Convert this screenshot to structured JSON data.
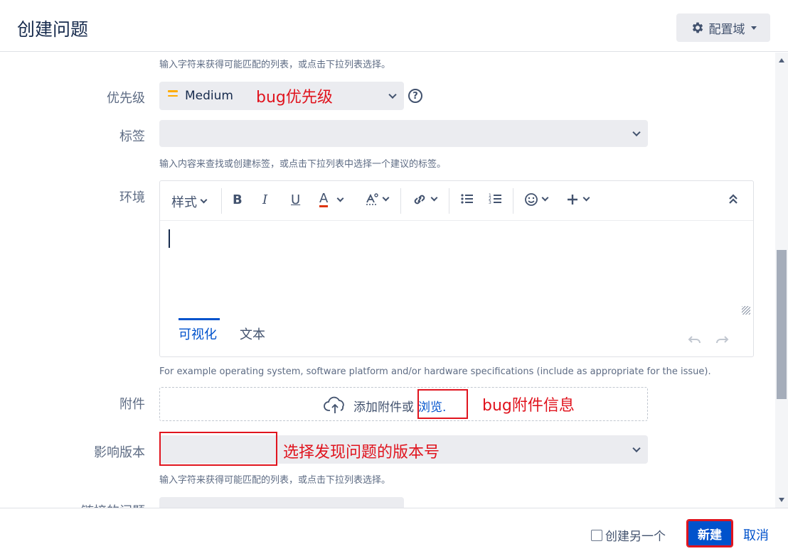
{
  "header": {
    "title": "创建问题",
    "config_label": "配置域"
  },
  "form": {
    "component_help": "输入字符来获得可能匹配的列表，或点击下拉列表选择。",
    "priority": {
      "label": "优先级",
      "value": "Medium",
      "icon": "priority-medium-icon",
      "annotation": "bug优先级"
    },
    "labels": {
      "label": "标签",
      "help": "输入内容来查找或创建标签，或点击下拉列表中选择一个建议的标签。"
    },
    "environment": {
      "label": "环境",
      "toolbar": {
        "style_label": "样式",
        "bold": "B",
        "italic": "I",
        "underline": "U",
        "text_color": "A"
      },
      "tabs": [
        "可视化",
        "文本"
      ],
      "help": "For example operating system, software platform and/or hardware specifications (include as appropriate for the issue)."
    },
    "attachment": {
      "label": "附件",
      "drop_text": "添加附件或",
      "browse_link": "浏览.",
      "annotation": "bug附件信息"
    },
    "affects_version": {
      "label": "影响版本",
      "annotation": "选择发现问题的版本号",
      "help": "输入字符来获得可能匹配的列表，或点击下拉列表选择。"
    },
    "next_label_partial": "链接的问题"
  },
  "footer": {
    "create_another": "创建另一个",
    "create_button": "新建",
    "cancel_link": "取消"
  },
  "colors": {
    "accent": "#0052cc",
    "annotation_red": "#e0141e",
    "priority_medium": "#ffab00"
  }
}
